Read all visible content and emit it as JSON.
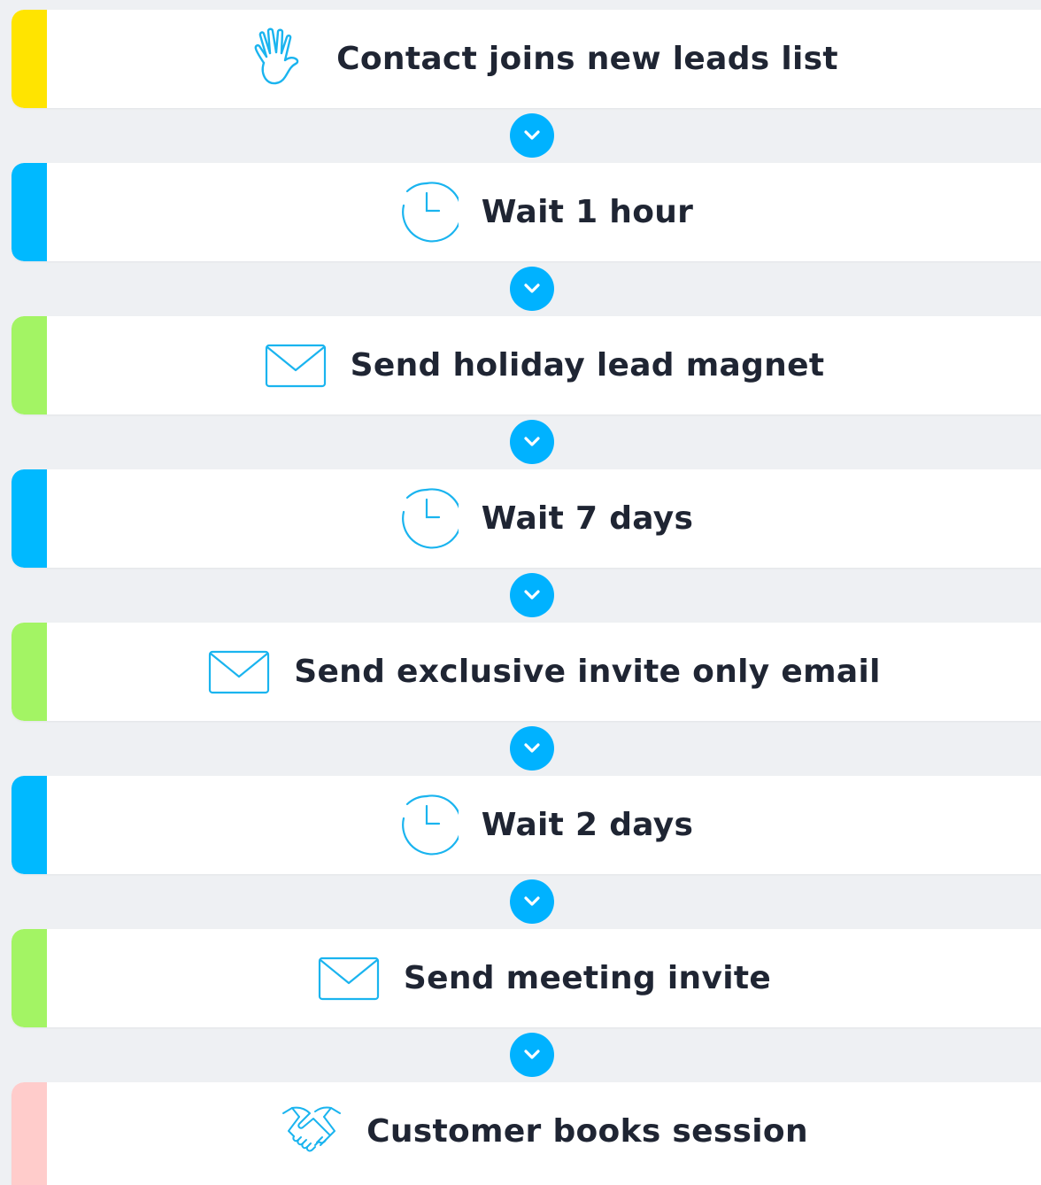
{
  "colors": {
    "trigger": "#ffe400",
    "wait": "#00b9ff",
    "email": "#a3f464",
    "goal": "#ffcccb",
    "icon_stroke": "#1ab4ef",
    "connector": "#00b2ff"
  },
  "steps": [
    {
      "type": "trigger",
      "icon": "hand-icon",
      "label": "Contact joins new leads list"
    },
    {
      "type": "wait",
      "icon": "clock-icon",
      "label": "Wait 1 hour"
    },
    {
      "type": "email",
      "icon": "envelope-icon",
      "label": "Send holiday lead magnet"
    },
    {
      "type": "wait",
      "icon": "clock-icon",
      "label": "Wait 7 days"
    },
    {
      "type": "email",
      "icon": "envelope-icon",
      "label": "Send exclusive invite only email"
    },
    {
      "type": "wait",
      "icon": "clock-icon",
      "label": "Wait 2 days"
    },
    {
      "type": "email",
      "icon": "envelope-icon",
      "label": "Send meeting invite"
    },
    {
      "type": "goal",
      "icon": "handshake-icon",
      "label": "Customer books session"
    }
  ]
}
